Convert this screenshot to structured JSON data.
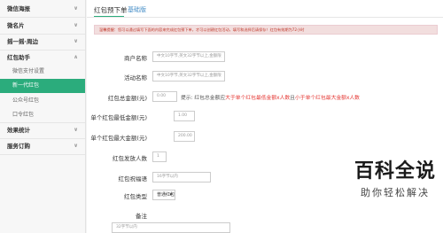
{
  "sidebar": {
    "items": [
      {
        "label": "微信海报",
        "chev": "∨"
      },
      {
        "label": "微名片",
        "chev": "∨"
      },
      {
        "label": "摇一摇·周边",
        "chev": "∨"
      },
      {
        "label": "红包助手",
        "chev": "∧"
      },
      {
        "label": "微信支付设置"
      },
      {
        "label": "新一代红包"
      },
      {
        "label": "公众号红包"
      },
      {
        "label": "口令红包"
      },
      {
        "label": "效果统计",
        "chev": "∨"
      },
      {
        "label": "服务订购",
        "chev": "∨"
      }
    ]
  },
  "header": {
    "title": "红包预下单",
    "subtitle": "基础版"
  },
  "notice": "温馨提醒：您可以通过填写下面的内容来完成红包预下单，才可以创建红包活动，填写和选择后请保存！红包有效期为72小时",
  "form": {
    "merchant_name": {
      "label": "商户名称",
      "placeholder": "中文10字节,英文32字节以上,金额限"
    },
    "activity_name": {
      "label": "活动名称",
      "placeholder": "中文10字节,英文32字节以上,金额限"
    },
    "total_amount": {
      "label": "红包总金额(元)",
      "value": "0.00",
      "tip_prefix": "提示: 红包总金额应",
      "tip_red1": "大于单个红包最低金额x人数",
      "tip_mid": "且",
      "tip_red2": "小于单个红包最大金额x人数"
    },
    "min_amount": {
      "label": "单个红包最低金额(元)",
      "value": "1.00"
    },
    "max_amount": {
      "label": "单个红包最大金额(元)",
      "value": "200.00"
    },
    "send_count": {
      "label": "红包发放人数",
      "value": "1"
    },
    "wishing": {
      "label": "红包祝福语",
      "placeholder": "16字节以内"
    },
    "type": {
      "label": "红包类型",
      "selected": "普通红包",
      "caret": "▾"
    },
    "remark": {
      "label": "备注",
      "placeholder": "32字节以内"
    }
  },
  "watermark": {
    "logo": "百科全说",
    "slogan": "助你轻松解决"
  }
}
